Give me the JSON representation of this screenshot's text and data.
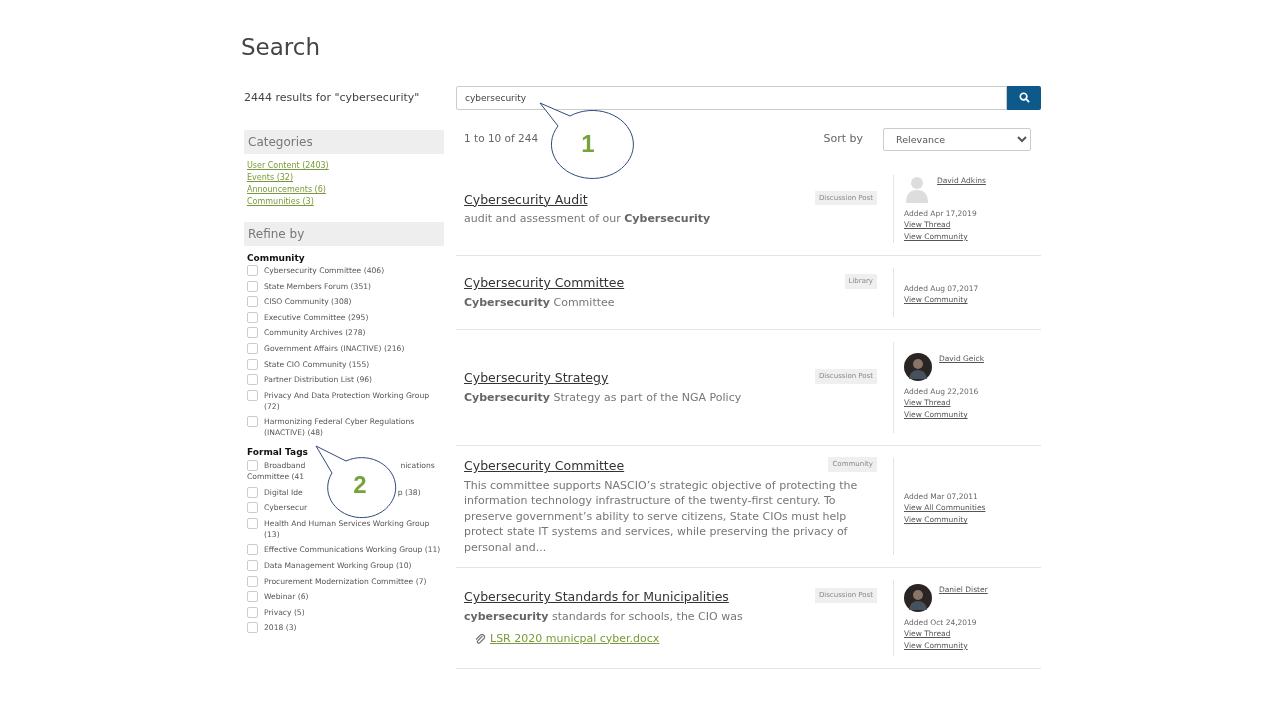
{
  "page_title": "Search",
  "results_summary": "2444 results for \"cybersecurity\"",
  "search": {
    "value": "cybersecurity"
  },
  "range_text": "1 to 10 of 244",
  "sort": {
    "label": "Sort by",
    "value": "Relevance"
  },
  "categories": {
    "title": "Categories",
    "links": [
      "User Content (2403)",
      "Events (32)",
      "Announcements (6)",
      "Communities (3)"
    ]
  },
  "refine": {
    "title": "Refine by",
    "groups": [
      {
        "title": "Community",
        "items": [
          {
            "parts": [
              "Cybersecurity Committee (406)"
            ],
            "checked": false
          },
          {
            "parts": [
              "State Members Forum (351)"
            ],
            "checked": false
          },
          {
            "parts": [
              "CISO Community (308)"
            ],
            "checked": false
          },
          {
            "parts": [
              "Executive Committee (295)"
            ],
            "checked": false
          },
          {
            "parts": [
              "Community Archives (278)"
            ],
            "checked": false
          },
          {
            "parts": [
              "Government Affairs (INACTIVE) (216)"
            ],
            "checked": false
          },
          {
            "parts": [
              "State CIO Community (155)"
            ],
            "checked": false
          },
          {
            "parts": [
              "Partner Distribution List (96)"
            ],
            "checked": false
          },
          {
            "parts": [
              "Privacy And Data Protection Working Group (72)"
            ],
            "checked": false
          },
          {
            "parts": [
              "Harmonizing Federal Cyber Regulations (INACTIVE) (48)"
            ],
            "checked": false
          }
        ]
      },
      {
        "title": "Formal Tags",
        "items": [
          {
            "parts": [
              "Broadband",
              "nications",
              "Committee (41"
            ],
            "checked": false
          },
          {
            "parts": [
              "Digital Ide",
              "p (38)"
            ],
            "checked": false
          },
          {
            "parts": [
              "Cybersecur"
            ],
            "checked": false
          },
          {
            "parts": [
              "Health And Human Services Working Group (13)"
            ],
            "checked": false
          },
          {
            "parts": [
              "Effective Communications Working Group (11)"
            ],
            "checked": false
          },
          {
            "parts": [
              "Data Management Working Group (10)"
            ],
            "checked": false
          },
          {
            "parts": [
              "Procurement Modernization Committee (7)"
            ],
            "checked": false
          },
          {
            "parts": [
              "Webinar (6)"
            ],
            "checked": false
          },
          {
            "parts": [
              "Privacy (5)"
            ],
            "checked": false
          },
          {
            "parts": [
              "2018 (3)"
            ],
            "checked": false
          }
        ]
      }
    ]
  },
  "results": [
    {
      "title": "Cybersecurity Audit",
      "type": "Discussion Post",
      "snippet": "audit and assessment of our **Cybersecurity**",
      "avatar": {
        "kind": "placeholder"
      },
      "author": "David Adkins",
      "added": "Added Apr 17,2019",
      "links": [
        "View Thread",
        "View Community"
      ]
    },
    {
      "title": "Cybersecurity Committee",
      "type": "Library",
      "snippet": "**Cybersecurity** Committee",
      "added": "Added Aug 07,2017",
      "links": [
        "View Community"
      ]
    },
    {
      "title": "Cybersecurity Strategy",
      "type": "Discussion Post",
      "snippet": "**Cybersecurity** Strategy as part of the NGA Policy",
      "avatar": {
        "kind": "photo"
      },
      "author": "David Geick",
      "added": "Added Aug 22,2016",
      "links": [
        "View Thread",
        "View Community"
      ]
    },
    {
      "title": "Cybersecurity Committee",
      "type": "Community",
      "snippet": "This committee supports NASCIO’s strategic objective of protecting the information technology infrastructure of the twenty-first century. To preserve government’s ability to serve citizens, State CIOs must help protect state IT systems and services, while preserving the privacy of personal and...",
      "added": "Added Mar 07,2011",
      "links": [
        "View All Communities",
        "View Community"
      ]
    },
    {
      "title": "Cybersecurity Standards for Municipalities",
      "type": "Discussion Post",
      "snippet": "**cybersecurity** standards for schools, the CIO was",
      "attachment": "LSR 2020 municpal cyber.docx",
      "avatar": {
        "kind": "photo"
      },
      "author": "Daniel Dister",
      "added": "Added Oct 24,2019",
      "links": [
        "View Thread",
        "View Community"
      ]
    }
  ],
  "callouts": [
    {
      "number": "1"
    },
    {
      "number": "2"
    }
  ]
}
